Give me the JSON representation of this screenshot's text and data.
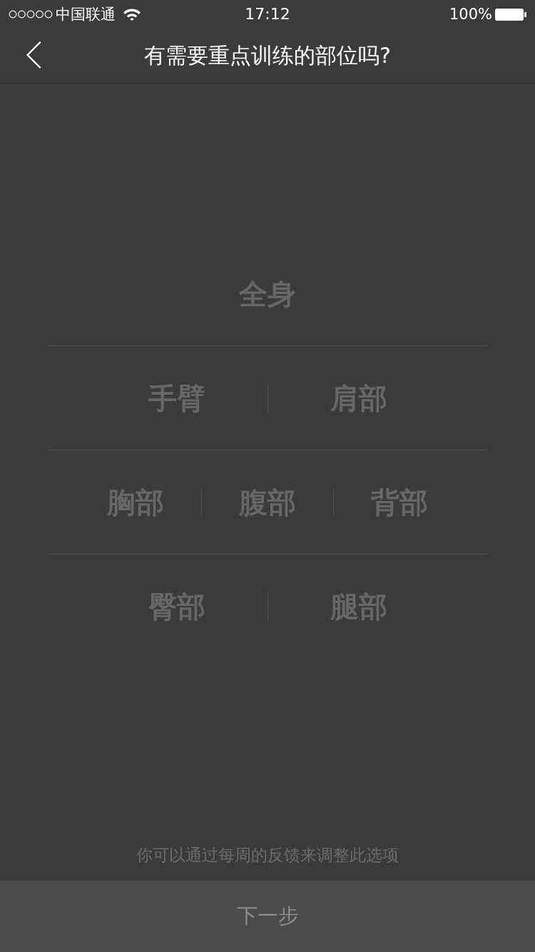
{
  "status_bar": {
    "carrier": "中国联通",
    "time": "17:12",
    "battery": "100%"
  },
  "nav_bar": {
    "title": "有需要重点训练的部位吗?"
  },
  "body_parts": {
    "rows": [
      {
        "options": [
          {
            "label": "全身",
            "selected": false
          }
        ]
      },
      {
        "options": [
          {
            "label": "手臂",
            "selected": false
          },
          {
            "label": "肩部",
            "selected": false
          }
        ]
      },
      {
        "options": [
          {
            "label": "胸部",
            "selected": false
          },
          {
            "label": "腹部",
            "selected": false
          },
          {
            "label": "背部",
            "selected": false
          }
        ]
      },
      {
        "options": [
          {
            "label": "臀部",
            "selected": false
          },
          {
            "label": "腿部",
            "selected": false
          }
        ]
      }
    ]
  },
  "hint": "你可以通过每周的反馈来调整此选项",
  "next_button": {
    "label": "下一步"
  }
}
